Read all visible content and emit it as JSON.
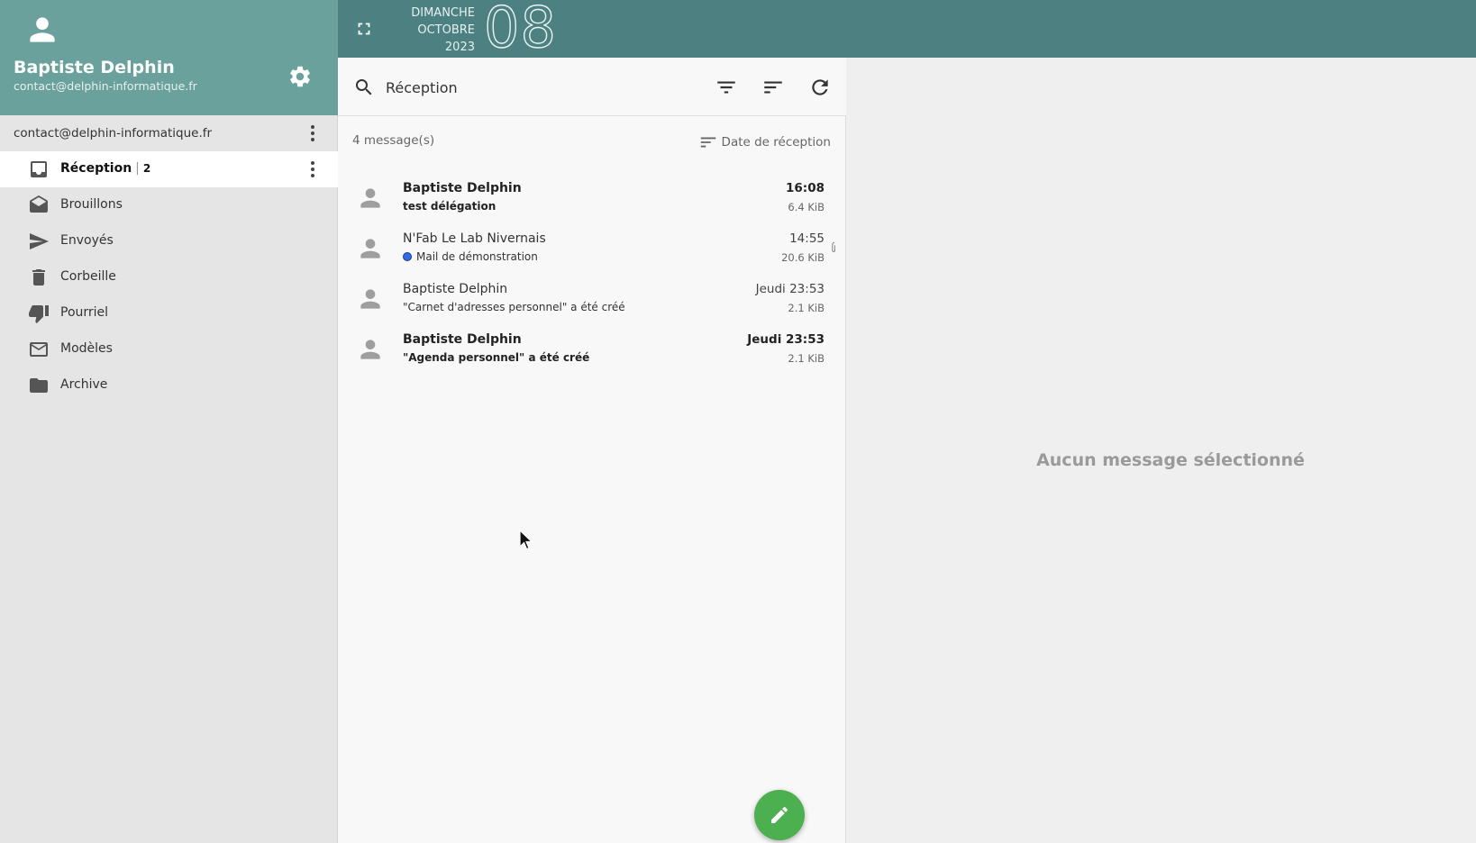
{
  "profile": {
    "name": "Baptiste Delphin",
    "email": "contact@delphin-informatique.fr"
  },
  "account": {
    "label": "contact@delphin-informatique.fr"
  },
  "folders": [
    {
      "label": "Réception",
      "count": "2",
      "icon": "inbox-icon",
      "active": true
    },
    {
      "label": "Brouillons",
      "icon": "drafts-icon"
    },
    {
      "label": "Envoyés",
      "icon": "send-icon"
    },
    {
      "label": "Corbeille",
      "icon": "trash-icon"
    },
    {
      "label": "Pourriel",
      "icon": "thumbs-down-icon"
    },
    {
      "label": "Modèles",
      "icon": "mail-outline-icon"
    },
    {
      "label": "Archive",
      "icon": "folder-icon"
    }
  ],
  "topbar": {
    "weekday": "DIMANCHE",
    "month": "OCTOBRE",
    "year": "2023",
    "day": "08"
  },
  "search": {
    "value": "Réception"
  },
  "list": {
    "count_label": "4 message(s)",
    "sort_label": "Date de réception",
    "messages": [
      {
        "from": "Baptiste Delphin",
        "subject": "test délégation",
        "time": "16:08",
        "size": "6.4 KiB",
        "unread": true
      },
      {
        "from": "N'Fab Le Lab Nivernais",
        "subject": "Mail de démonstration",
        "time": "14:55",
        "size": "20.6 KiB",
        "unread": false,
        "tagged": true,
        "attachment": true
      },
      {
        "from": "Baptiste Delphin",
        "subject": "\"Carnet d'adresses personnel\" a été créé",
        "time": "Jeudi 23:53",
        "size": "2.1 KiB",
        "unread": false
      },
      {
        "from": "Baptiste Delphin",
        "subject": "\"Agenda personnel\" a été créé",
        "time": "Jeudi 23:53",
        "size": "2.1 KiB",
        "unread": true
      }
    ]
  },
  "reader": {
    "empty_label": "Aucun message sélectionné"
  },
  "colors": {
    "profile_bg": "#6aa19c",
    "topbar_bg": "#4d8181",
    "compose_bg": "#4caf50",
    "tag_dot": "#2f6be3"
  }
}
